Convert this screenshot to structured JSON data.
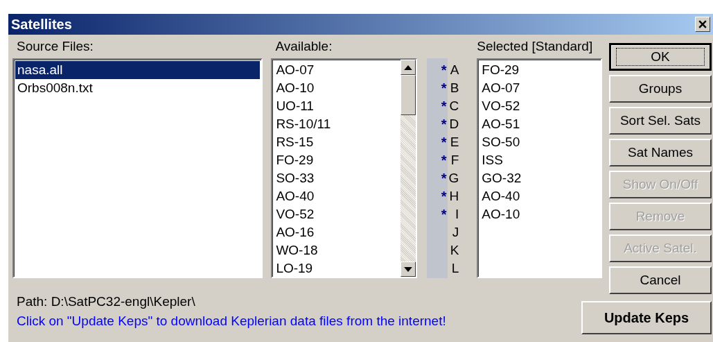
{
  "window": {
    "title": "Satellites"
  },
  "source_files": {
    "label": "Source Files:",
    "items": [
      {
        "label": "nasa.all",
        "selected": true
      },
      {
        "label": "Orbs008n.txt",
        "selected": false
      }
    ]
  },
  "available": {
    "label": "Available:",
    "items": [
      {
        "label": "AO-07",
        "selected": false
      },
      {
        "label": "AO-10",
        "selected": false
      },
      {
        "label": "UO-11",
        "selected": false
      },
      {
        "label": "RS-10/11",
        "selected": false
      },
      {
        "label": "RS-15",
        "selected": false
      },
      {
        "label": "FO-29",
        "selected": false
      },
      {
        "label": "SO-33",
        "selected": false
      },
      {
        "label": "AO-40",
        "selected": false
      },
      {
        "label": "VO-52",
        "selected": false
      },
      {
        "label": "AO-16",
        "selected": false
      },
      {
        "label": "WO-18",
        "selected": false
      },
      {
        "label": "LO-19",
        "selected": false
      }
    ]
  },
  "slots": [
    {
      "marker": "*",
      "letter": "A"
    },
    {
      "marker": "*",
      "letter": "B"
    },
    {
      "marker": "*",
      "letter": "C"
    },
    {
      "marker": "*",
      "letter": "D"
    },
    {
      "marker": "*",
      "letter": "E"
    },
    {
      "marker": "*",
      "letter": "F"
    },
    {
      "marker": "*",
      "letter": "G"
    },
    {
      "marker": "*",
      "letter": "H"
    },
    {
      "marker": "*",
      "letter": "I"
    },
    {
      "letter": "J"
    },
    {
      "letter": "K"
    },
    {
      "letter": "L"
    }
  ],
  "selected": {
    "label": "Selected [Standard]",
    "items": [
      {
        "label": "FO-29",
        "selected": false
      },
      {
        "label": "AO-07",
        "selected": false
      },
      {
        "label": "VO-52",
        "selected": false
      },
      {
        "label": "AO-51",
        "selected": false
      },
      {
        "label": "SO-50",
        "selected": false
      },
      {
        "label": "ISS",
        "selected": false
      },
      {
        "label": "GO-32",
        "selected": false
      },
      {
        "label": "AO-40",
        "selected": false
      },
      {
        "label": "AO-10",
        "selected": false
      }
    ]
  },
  "buttons": [
    {
      "label": "OK",
      "default": true,
      "disabled": false
    },
    {
      "label": "Groups",
      "default": false,
      "disabled": false
    },
    {
      "label": "Sort Sel. Sats",
      "default": false,
      "disabled": false
    },
    {
      "label": "Sat Names",
      "default": false,
      "disabled": false
    },
    {
      "label": "Show  On/Off",
      "default": false,
      "disabled": true
    },
    {
      "label": "Remove",
      "default": false,
      "disabled": true
    },
    {
      "label": "Active Satel.",
      "default": false,
      "disabled": true
    },
    {
      "label": "Cancel",
      "default": false,
      "disabled": false
    }
  ],
  "path": "Path: D:\\SatPC32-engl\\Kepler\\",
  "hint": "Click on \"Update Keps\" to download Keplerian data files from the internet!",
  "update_button": {
    "label": "Update Keps"
  }
}
